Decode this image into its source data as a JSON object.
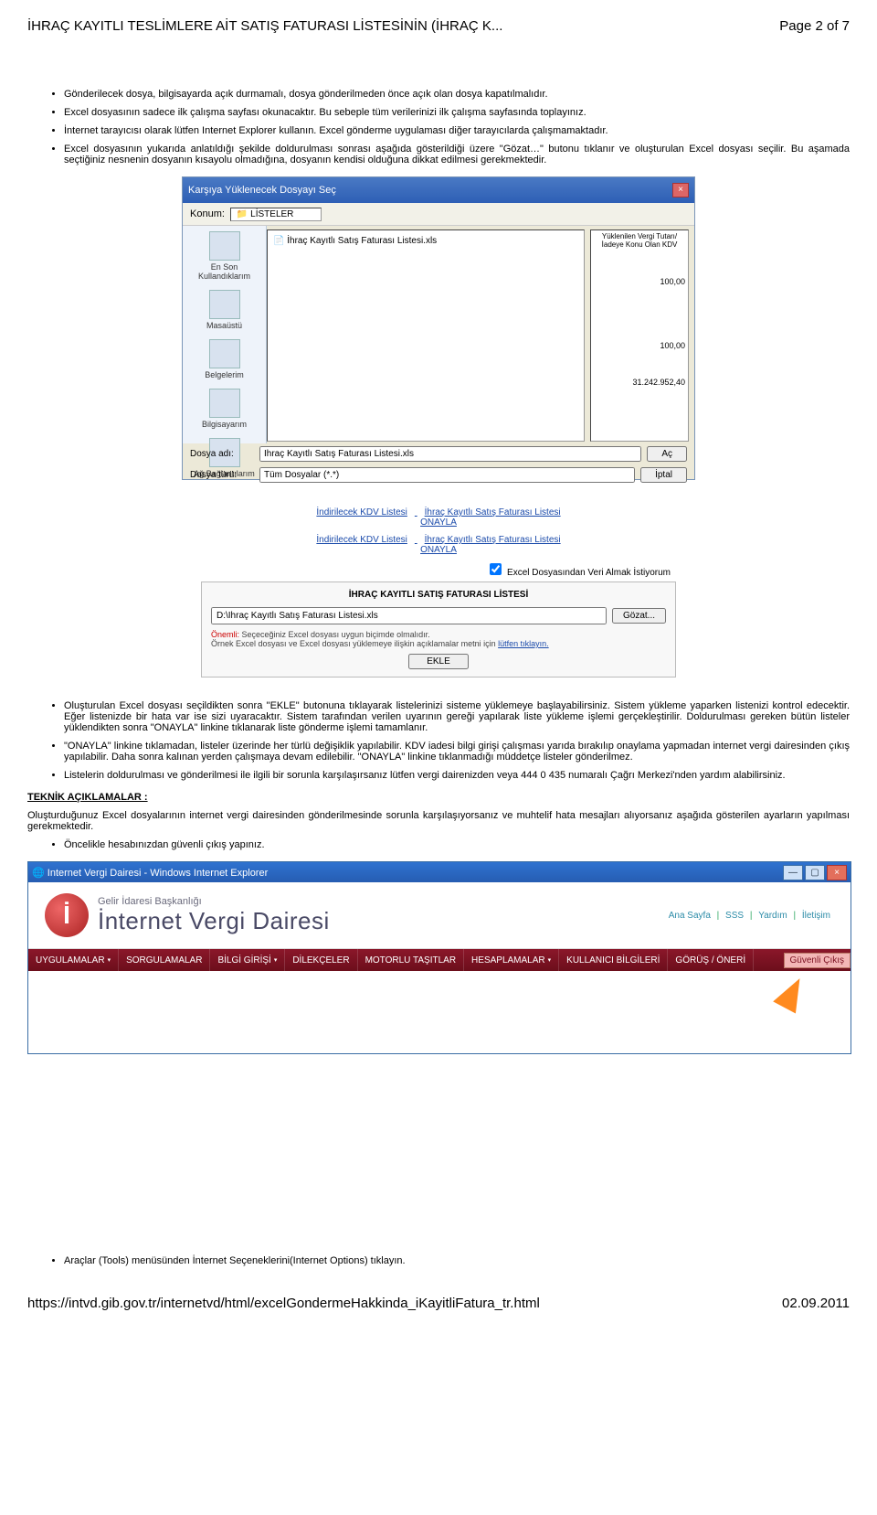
{
  "header": {
    "title": "İHRAÇ KAYITLI TESLİMLERE AİT SATIŞ FATURASI LİSTESİNİN (İHRAÇ K...",
    "page": "Page 2 of 7"
  },
  "bullets1": [
    "Gönderilecek dosya, bilgisayarda açık durmamalı, dosya gönderilmeden önce açık olan dosya kapatılmalıdır.",
    "Excel dosyasının sadece ilk çalışma sayfası okunacaktır. Bu sebeple tüm verilerinizi ilk çalışma sayfasında toplayınız.",
    "İnternet tarayıcısı olarak lütfen Internet Explorer kullanın. Excel gönderme uygulaması diğer tarayıcılarda çalışmamaktadır.",
    "Excel dosyasının yukarıda anlatıldığı şekilde doldurulması sonrası aşağıda gösterildiği üzere \"Gözat…\" butonu tıklanır ve oluşturulan Excel dosyası seçilir. Bu aşamada seçtiğiniz nesnenin dosyanın kısayolu olmadığına, dosyanın kendisi olduğuna dikkat edilmesi gerekmektedir."
  ],
  "dialog1": {
    "title": "Karşıya Yüklenecek Dosyayı Seç",
    "konum_label": "Konum:",
    "konum_value": "LİSTELER",
    "side": [
      "En Son Kullandıklarım",
      "Masaüstü",
      "Belgelerim",
      "Bilgisayarım",
      "Ağ Bağlantılarım"
    ],
    "file_row": "İhraç Kayıtlı Satış Faturası Listesi.xls",
    "right_header": "Yüklenilen Vergi Tutarı/İadeye Konu Olan KDV",
    "right_val1": "100,00",
    "right_val2": "100,00",
    "right_total": "31.242.952,40",
    "dosya_adi_label": "Dosya adı:",
    "dosya_adi_value": "İhraç Kayıtlı Satış Faturası Listesi.xls",
    "dosya_turu_label": "Dosya türü:",
    "dosya_turu_value": "Tüm Dosyalar (*.*)",
    "btn_ac": "Aç",
    "btn_iptal": "İptal",
    "link1": "İndirilecek KDV Listesi",
    "link2": "İhraç Kayıtlı Satış Faturası Listesi",
    "link3": "ONAYLA"
  },
  "panel2": {
    "link1": "İndirilecek KDV Listesi",
    "link2": "İhraç Kayıtlı Satış Faturası Listesi",
    "link3": "ONAYLA",
    "check_label": "Excel Dosyasından Veri Almak İstiyorum",
    "tab_title": "İHRAÇ KAYITLI SATIŞ FATURASI LİSTESİ",
    "path": "D:\\İhraç Kayıtlı Satış Faturası Listesi.xls",
    "gozat": "Gözat...",
    "hint_red": "Önemli:",
    "hint1": " Seçeceğiniz Excel dosyası uygun biçimde olmalıdır.",
    "hint2": "Örnek Excel dosyası ve Excel dosyası yüklemeye ilişkin açıklamalar metni için ",
    "hint_link": "lütfen tıklayın.",
    "ekle": "EKLE"
  },
  "bullets2": [
    "Oluşturulan Excel dosyası seçildikten sonra \"EKLE\" butonuna tıklayarak listelerinizi sisteme yüklemeye başlayabilirsiniz. Sistem yükleme yaparken listenizi kontrol edecektir. Eğer listenizde bir hata var ise sizi uyaracaktır. Sistem tarafından verilen uyarının gereği yapılarak liste yükleme işlemi gerçekleştirilir. Doldurulması gereken bütün listeler yüklendikten sonra \"ONAYLA\" linkine tıklanarak liste gönderme işlemi tamamlanır.",
    "\"ONAYLA\" linkine tıklamadan, listeler üzerinde her türlü değişiklik yapılabilir. KDV iadesi bilgi girişi çalışması yarıda bırakılıp onaylama yapmadan internet vergi dairesinden çıkış yapılabilir. Daha sonra kalınan yerden çalışmaya devam edilebilir. \"ONAYLA\" linkine tıklanmadığı müddetçe listeler gönderilmez.",
    "Listelerin doldurulması ve gönderilmesi ile ilgili bir sorunla karşılaşırsanız lütfen vergi dairenizden veya 444 0 435 numaralı Çağrı Merkezi'nden yardım alabilirsiniz."
  ],
  "tech": {
    "heading": "TEKNİK AÇIKLAMALAR :",
    "para": "Oluşturduğunuz Excel dosyalarının internet vergi dairesinden gönderilmesinde sorunla karşılaşıyorsanız ve muhtelif hata mesajları alıyorsanız aşağıda gösterilen ayarların yapılması gerekmektedir.",
    "bullet": "Öncelikle hesabınızdan güvenli çıkış yapınız."
  },
  "ie": {
    "title": "Internet Vergi Dairesi - Windows Internet Explorer",
    "logo_sub": "Gelir İdaresi Başkanlığı",
    "logo_main": "İnternet Vergi Dairesi",
    "top_links": [
      "Ana Sayfa",
      "SSS",
      "Yardım",
      "İletişim"
    ],
    "nav": [
      "UYGULAMALAR",
      "SORGULAMALAR",
      "BİLGİ GİRİŞİ",
      "DİLEKÇELER",
      "MOTORLU TAŞITLAR",
      "HESAPLAMALAR",
      "KULLANICI BİLGİLERİ",
      "GÖRÜŞ / ÖNERİ"
    ],
    "pink_tab": "Güvenli Çıkış"
  },
  "bullets3": [
    "Araçlar (Tools) menüsünden İnternet Seçeneklerini(Internet Options) tıklayın."
  ],
  "footer": {
    "url": "https://intvd.gib.gov.tr/internetvd/html/excelGondermeHakkinda_iKayitliFatura_tr.html",
    "date": "02.09.2011"
  }
}
